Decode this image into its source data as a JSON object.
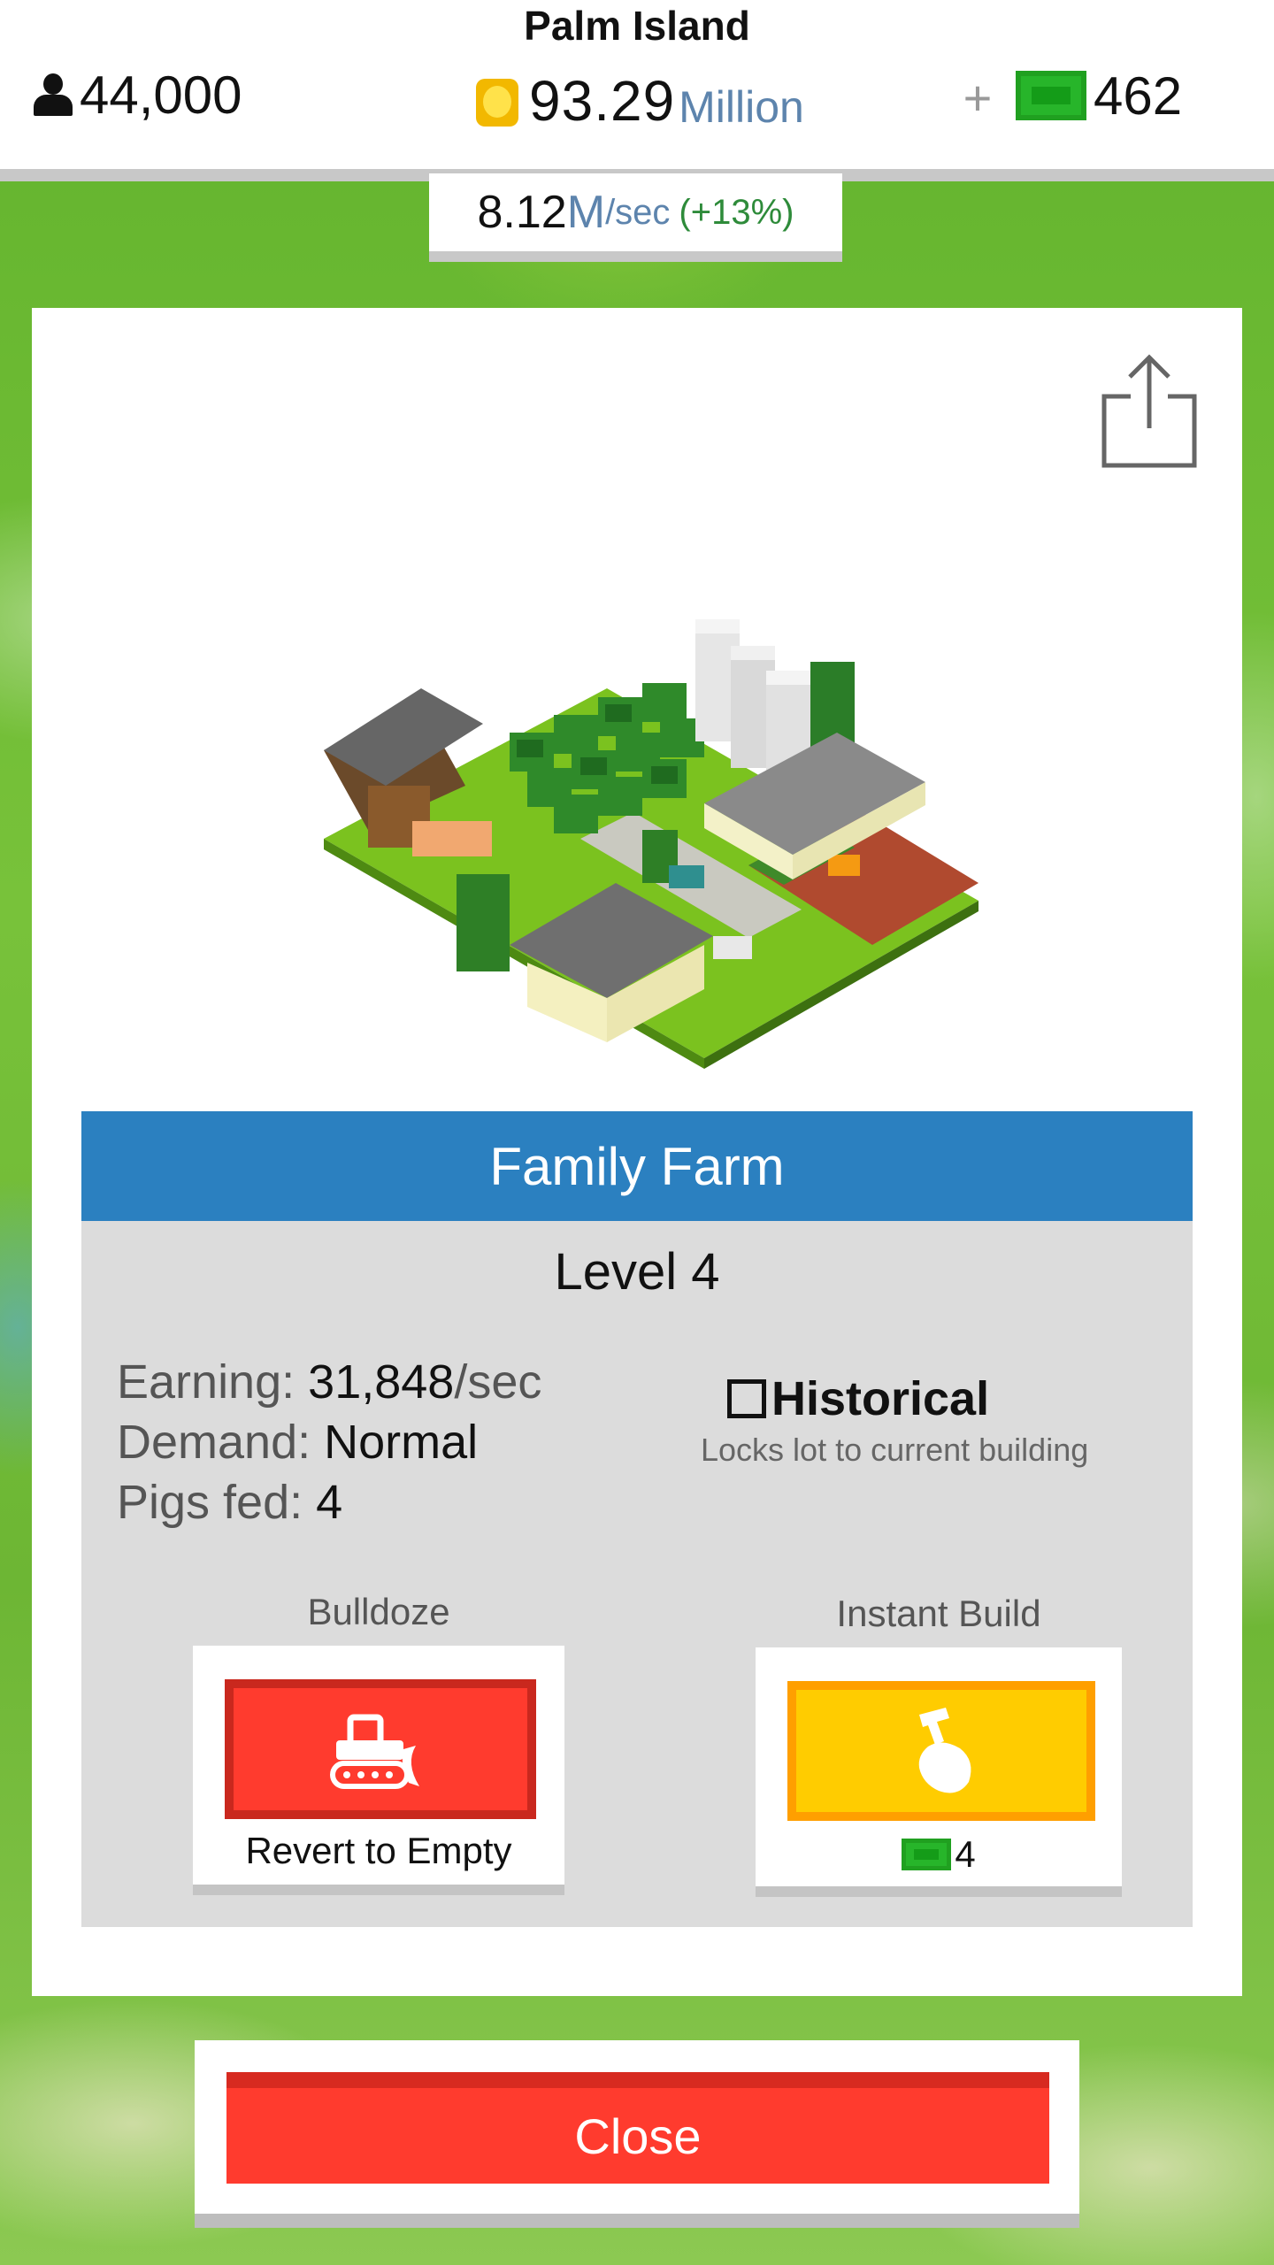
{
  "hud": {
    "island_name": "Palm Island",
    "population": "44,000",
    "coins_value": "93.29",
    "coins_unit": "Million",
    "plus_label": "+",
    "cash": "462",
    "rate_value": "8.12",
    "rate_unit": "M",
    "rate_per": "/sec",
    "rate_bonus": "(+13%)"
  },
  "icons": {
    "population": "person-icon",
    "coins": "coin-icon",
    "cash": "cash-icon",
    "share": "share-icon",
    "bulldozer": "bulldozer-icon",
    "hammer": "hammer-hand-icon"
  },
  "building": {
    "name": "Family Farm",
    "level": "Level 4",
    "earning_label": "Earning:",
    "earning_value": "31,848",
    "earning_unit": "/sec",
    "demand_label": "Demand:",
    "demand_value": "Normal",
    "pigs_label": "Pigs fed:",
    "pigs_value": "4",
    "historical_label": "Historical",
    "historical_checked": false,
    "historical_sub": "Locks lot to current building"
  },
  "actions": {
    "bulldoze_title": "Bulldoze",
    "bulldoze_caption": "Revert to Empty",
    "instant_title": "Instant Build",
    "instant_cost": "4"
  },
  "close_label": "Close",
  "colors": {
    "title_bar": "#2b80c0",
    "bulldoze": "#ff3b2e",
    "instant": "#ffcc00",
    "close": "#ff3b2e",
    "cash": "#27b52a",
    "rate_bonus": "#2e8b3a",
    "unit_text": "#5d84ad"
  }
}
